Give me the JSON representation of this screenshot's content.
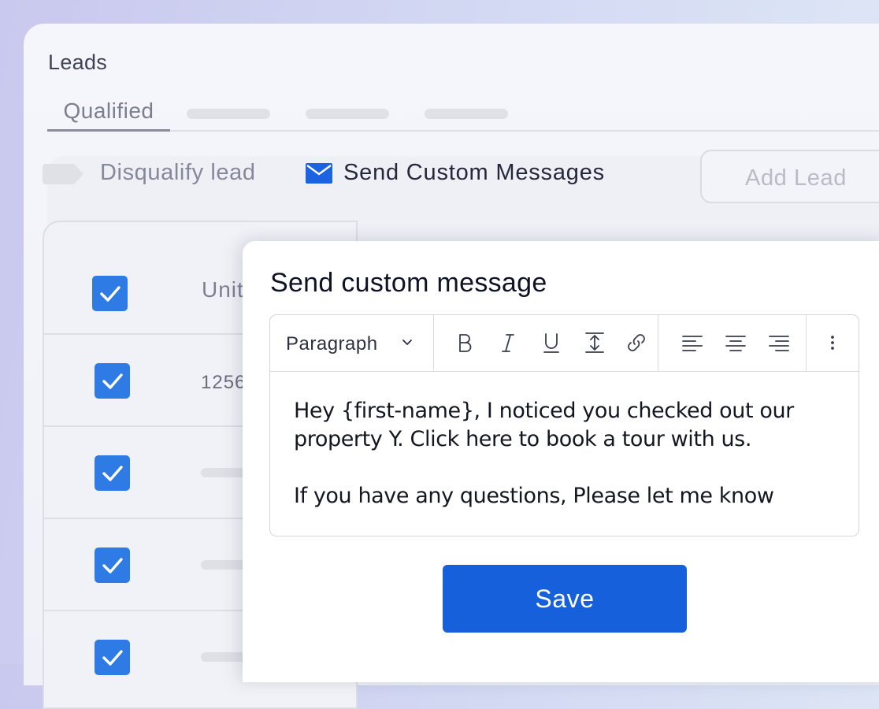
{
  "app": {
    "title": "Leads"
  },
  "tabs": [
    {
      "label": "Qualified",
      "active": true
    }
  ],
  "actions": {
    "disqualify_label": "Disqualify lead",
    "send_messages_label": "Send Custom Messages",
    "add_lead_label": "Add Lead"
  },
  "table": {
    "header_partial": "Unit",
    "rows": [
      {
        "checked": true,
        "cell_partial": "1256"
      },
      {
        "checked": true,
        "cell_partial": ""
      },
      {
        "checked": true,
        "cell_partial": ""
      },
      {
        "checked": true,
        "cell_partial": ""
      }
    ],
    "header_checked": true
  },
  "modal": {
    "title": "Send custom message",
    "format_select": "Paragraph",
    "toolbar_icons": [
      "bold-icon",
      "italic-icon",
      "underline-icon",
      "line-height-icon",
      "link-icon",
      "align-left-icon",
      "align-center-icon",
      "align-right-icon",
      "more-vertical-icon"
    ],
    "body_line1": "Hey {first-name}, I noticed you checked out our property Y. Click here to book a tour with us.",
    "body_line2": "If you have any questions, Please let me know",
    "save_label": "Save"
  },
  "colors": {
    "accent": "#1660dc",
    "checkbox": "#2e7be6",
    "mail_icon": "#1b63e0"
  }
}
